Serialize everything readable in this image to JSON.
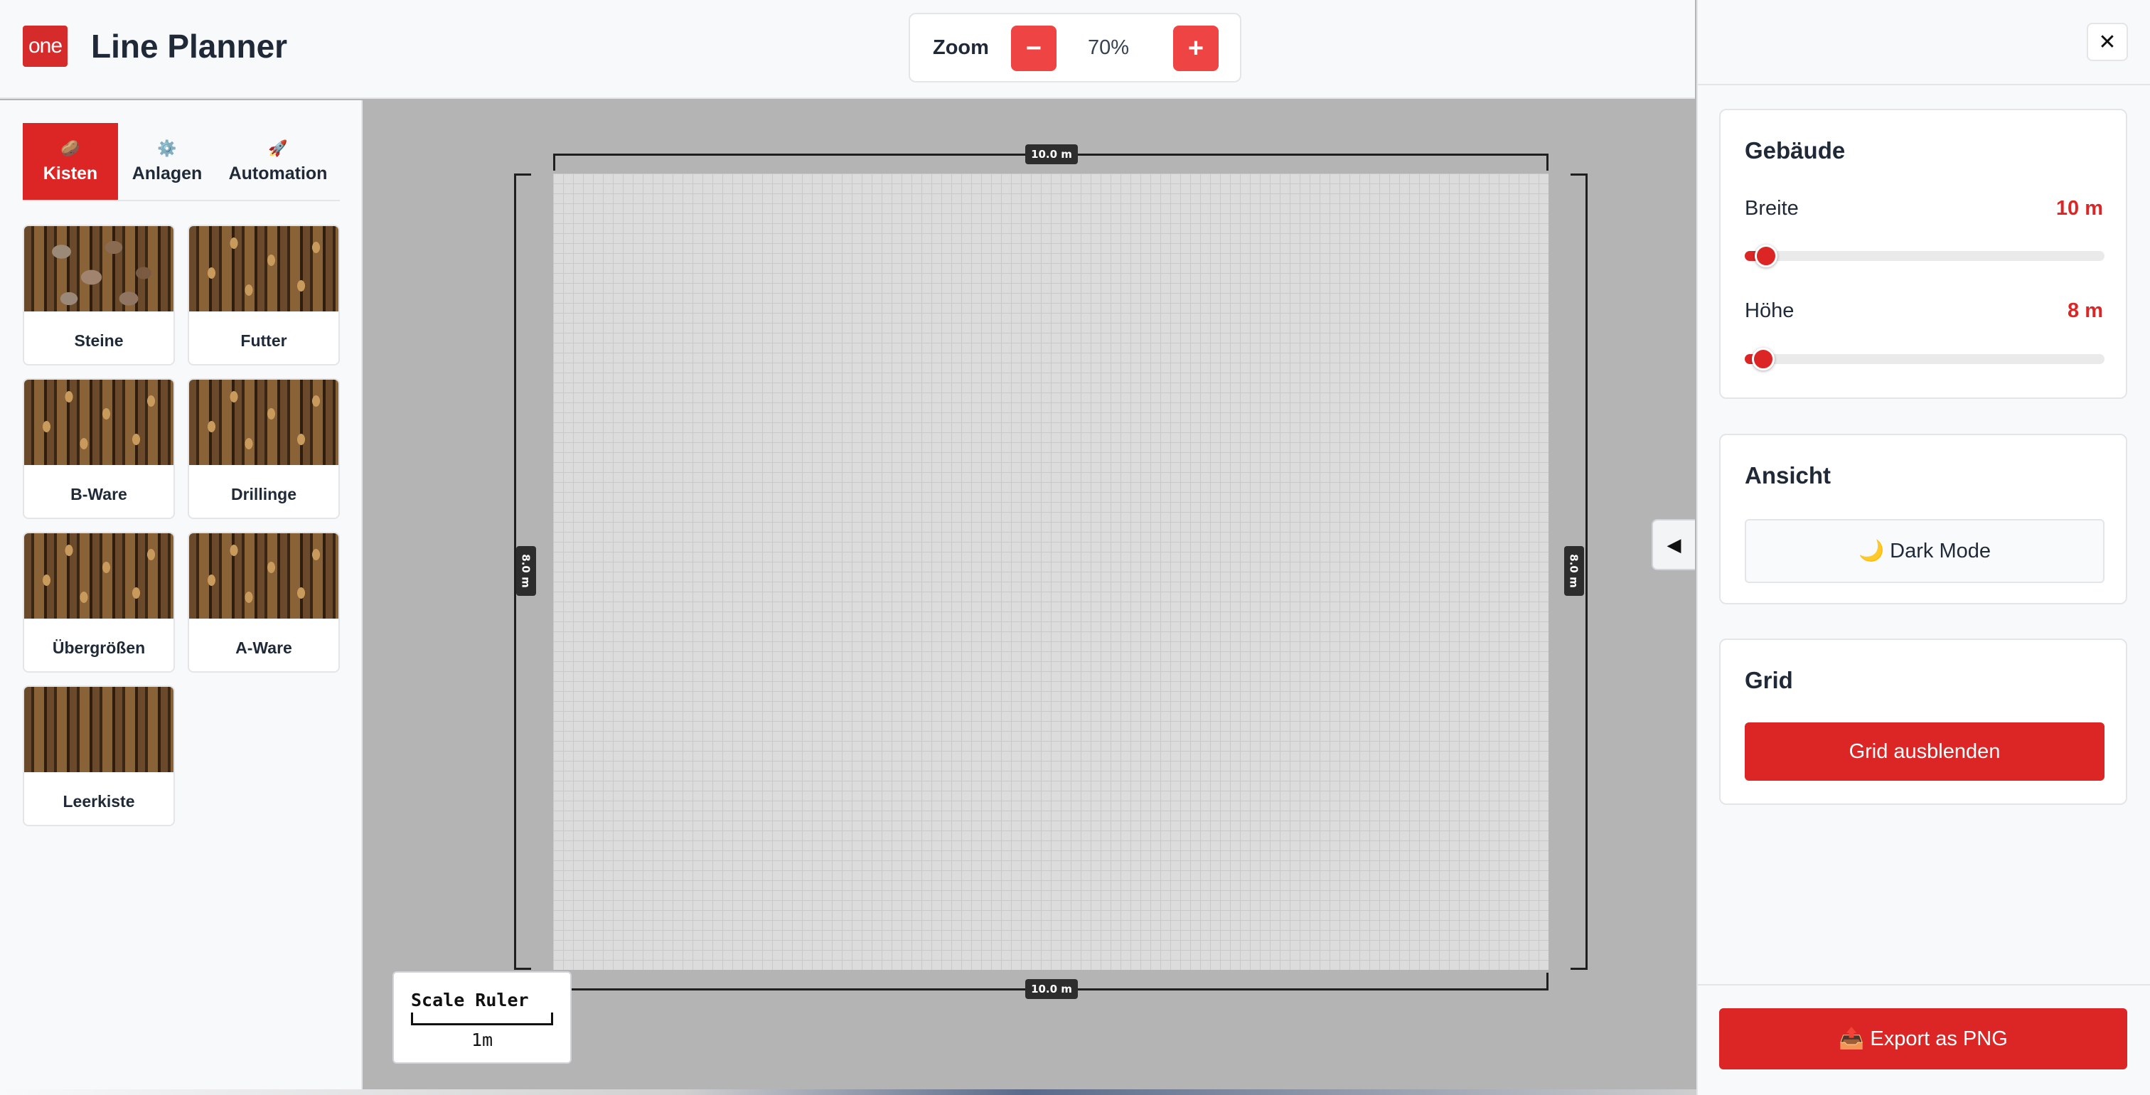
{
  "header": {
    "logo_text": "one",
    "app_title": "Line Planner",
    "zoom": {
      "label": "Zoom",
      "minus": "−",
      "plus": "+",
      "value": "70%"
    }
  },
  "sidebar": {
    "tabs": [
      {
        "icon": "🥔",
        "label": "Kisten",
        "active": true
      },
      {
        "icon": "⚙️",
        "label": "Anlagen",
        "active": false
      },
      {
        "icon": "🚀",
        "label": "Automation",
        "active": false
      }
    ],
    "items": [
      {
        "label": "Steine",
        "image": "crate-stones"
      },
      {
        "label": "Futter",
        "image": "crate-potatoes"
      },
      {
        "label": "B-Ware",
        "image": "crate-potatoes"
      },
      {
        "label": "Drillinge",
        "image": "crate-potatoes"
      },
      {
        "label": "Übergrößen",
        "image": "crate-potatoes"
      },
      {
        "label": "A-Ware",
        "image": "crate-potatoes"
      },
      {
        "label": "Leerkiste",
        "image": "crate-empty"
      }
    ]
  },
  "canvas": {
    "dim_top": "10.0 m",
    "dim_bottom": "10.0 m",
    "dim_left": "8.0 m",
    "dim_right": "8.0 m",
    "collapse_icon": "◀",
    "scale_ruler": {
      "title": "Scale Ruler",
      "unit": "1m"
    }
  },
  "panel": {
    "close": "✕",
    "building": {
      "title": "Gebäude",
      "width_label": "Breite",
      "width_value": "10 m",
      "height_label": "Höhe",
      "height_value": "8 m"
    },
    "view": {
      "title": "Ansicht",
      "dark_mode_button": "🌙 Dark Mode"
    },
    "grid": {
      "title": "Grid",
      "toggle_button": "Grid ausblenden"
    },
    "export_button": "📤 Export as PNG"
  },
  "colors": {
    "accent": "#dc2626",
    "canvas_bg": "#b4b4b4",
    "floor": "#dcdcdc"
  }
}
